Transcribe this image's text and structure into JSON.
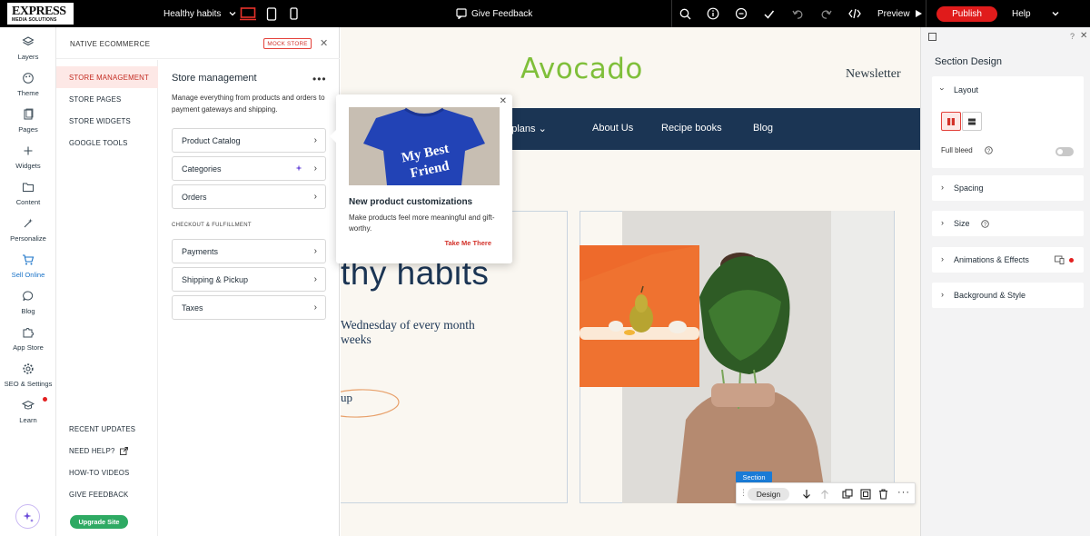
{
  "topbar": {
    "logo_main": "EXPRESS",
    "logo_sub": "MEDIA SOLUTIONS",
    "site_name": "Healthy habits",
    "feedback": "Give Feedback",
    "preview": "Preview",
    "publish": "Publish",
    "help": "Help"
  },
  "rail": {
    "items": [
      {
        "label": "Layers",
        "icon": "layers-icon"
      },
      {
        "label": "Theme",
        "icon": "palette-icon"
      },
      {
        "label": "Pages",
        "icon": "pages-icon"
      },
      {
        "label": "Widgets",
        "icon": "plus-icon"
      },
      {
        "label": "Content",
        "icon": "folder-icon"
      },
      {
        "label": "Personalize",
        "icon": "personalize-icon"
      },
      {
        "label": "Sell Online",
        "icon": "cart-icon"
      },
      {
        "label": "Blog",
        "icon": "chat-icon"
      },
      {
        "label": "App Store",
        "icon": "puzzle-icon"
      },
      {
        "label": "SEO & Settings",
        "icon": "gear-icon"
      },
      {
        "label": "Learn",
        "icon": "graduation-cap-icon"
      }
    ],
    "active": "Sell Online"
  },
  "panel": {
    "title": "NATIVE ECOMMERCE",
    "badge": "MOCK STORE",
    "nav": [
      "STORE MANAGEMENT",
      "STORE PAGES",
      "STORE WIDGETS",
      "GOOGLE TOOLS"
    ],
    "bottom_nav": [
      "RECENT UPDATES",
      "NEED HELP?",
      "HOW-TO VIDEOS",
      "GIVE FEEDBACK"
    ],
    "upgrade": "Upgrade Site",
    "heading": "Store management",
    "description": "Manage everything from products and orders to payment gateways and shipping.",
    "cards": [
      "Product Catalog",
      "Categories",
      "Orders"
    ],
    "section_label": "CHECKOUT & FULFILLMENT",
    "cards2": [
      "Payments",
      "Shipping & Pickup",
      "Taxes"
    ]
  },
  "popover": {
    "shirt_text_1": "My Best",
    "shirt_text_2": "Friend",
    "title": "New product customizations",
    "description": "Make products feel more meaningful and gift-worthy.",
    "link": "Take Me There"
  },
  "canvas": {
    "logo": "Avocado",
    "newsletter": "Newsletter",
    "nav": [
      "et plans",
      "About Us",
      "Recipe books",
      "Blog"
    ],
    "hero_title": "thy habits",
    "hero_sub": "Wednesday of every month\nweeks",
    "hero_btn": "up",
    "section_tag": "Section",
    "design_btn": "Design"
  },
  "rpanel": {
    "title": "Section Design",
    "layout": "Layout",
    "full_bleed": "Full bleed",
    "spacing": "Spacing",
    "size": "Size",
    "animations": "Animations & Effects",
    "background": "Background & Style"
  },
  "colors": {
    "accent": "#e01b1b",
    "link_blue": "#1a73c8",
    "navy": "#1b3554",
    "green": "#7fbf3a",
    "upgrade": "#2eaa63"
  }
}
